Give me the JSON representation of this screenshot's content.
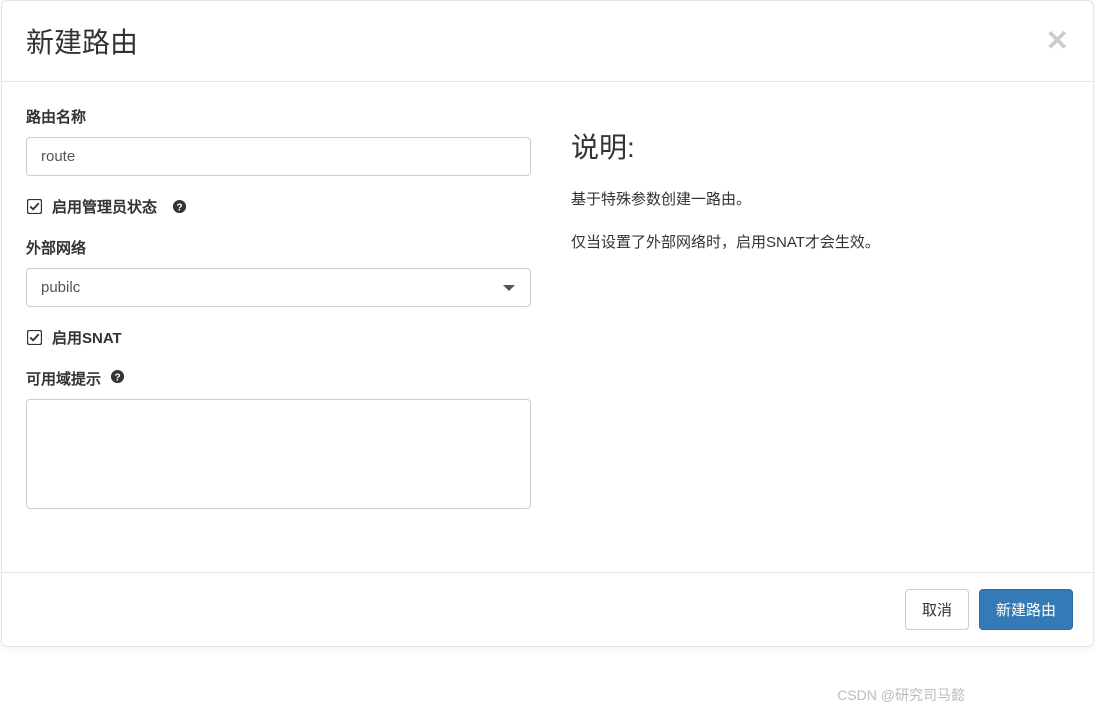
{
  "modal": {
    "title": "新建路由"
  },
  "form": {
    "route_name": {
      "label": "路由名称",
      "value": "route"
    },
    "admin_state": {
      "label": "启用管理员状态"
    },
    "external_network": {
      "label": "外部网络",
      "selected": "pubilc"
    },
    "enable_snat": {
      "label": "启用SNAT"
    },
    "availability_zone": {
      "label": "可用域提示"
    }
  },
  "description": {
    "title": "说明:",
    "line1": "基于特殊参数创建一路由。",
    "line2": "仅当设置了外部网络时，启用SNAT才会生效。"
  },
  "footer": {
    "cancel": "取消",
    "submit": "新建路由"
  },
  "watermark": "CSDN @研究司马懿"
}
